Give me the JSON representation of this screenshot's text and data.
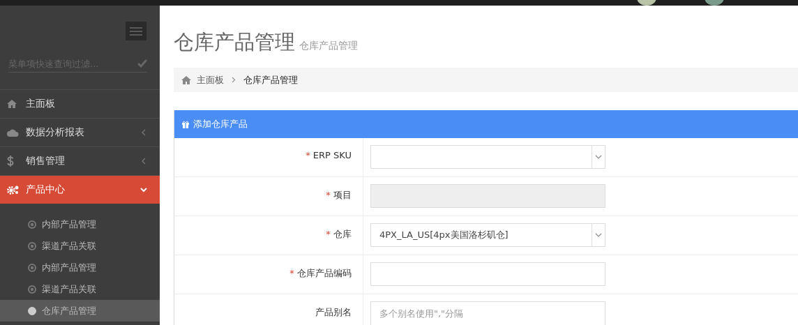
{
  "sidebar": {
    "search": {
      "placeholder": "菜单项快速查询过滤..."
    },
    "items": [
      {
        "label": "主面板",
        "kind": "link",
        "selected": false
      },
      {
        "label": "数据分析报表",
        "kind": "group",
        "expanded": false,
        "selected": false
      },
      {
        "label": "销售管理",
        "kind": "group",
        "expanded": false,
        "selected": false
      },
      {
        "label": "产品中心",
        "kind": "group",
        "expanded": true,
        "selected": true,
        "children": [
          {
            "label": "内部产品管理",
            "selected": false
          },
          {
            "label": "渠道产品关联",
            "selected": false
          },
          {
            "label": "内部产品管理",
            "selected": false
          },
          {
            "label": "渠道产品关联",
            "selected": false
          },
          {
            "label": "仓库产品管理",
            "selected": true
          }
        ]
      }
    ]
  },
  "page": {
    "title": "仓库产品管理",
    "subtitle": "仓库产品管理"
  },
  "breadcrumb": [
    {
      "label": "主面板"
    },
    {
      "label": "仓库产品管理"
    }
  ],
  "panel": {
    "title": "添加仓库产品",
    "fields": [
      {
        "label": "ERP SKU",
        "required_mark": "*",
        "kind": "select"
      },
      {
        "label": "项目",
        "required_mark": "*",
        "kind": "readonly"
      },
      {
        "label": "仓库",
        "required_mark": "*",
        "kind": "select",
        "value": "4PX_LA_US[4px美国洛杉矶仓]"
      },
      {
        "label": "仓库产品编码",
        "required_mark": "*",
        "kind": "input"
      },
      {
        "label": "产品别名",
        "kind": "textarea",
        "placeholder": "多个别名使用\",\"分隔"
      }
    ]
  }
}
